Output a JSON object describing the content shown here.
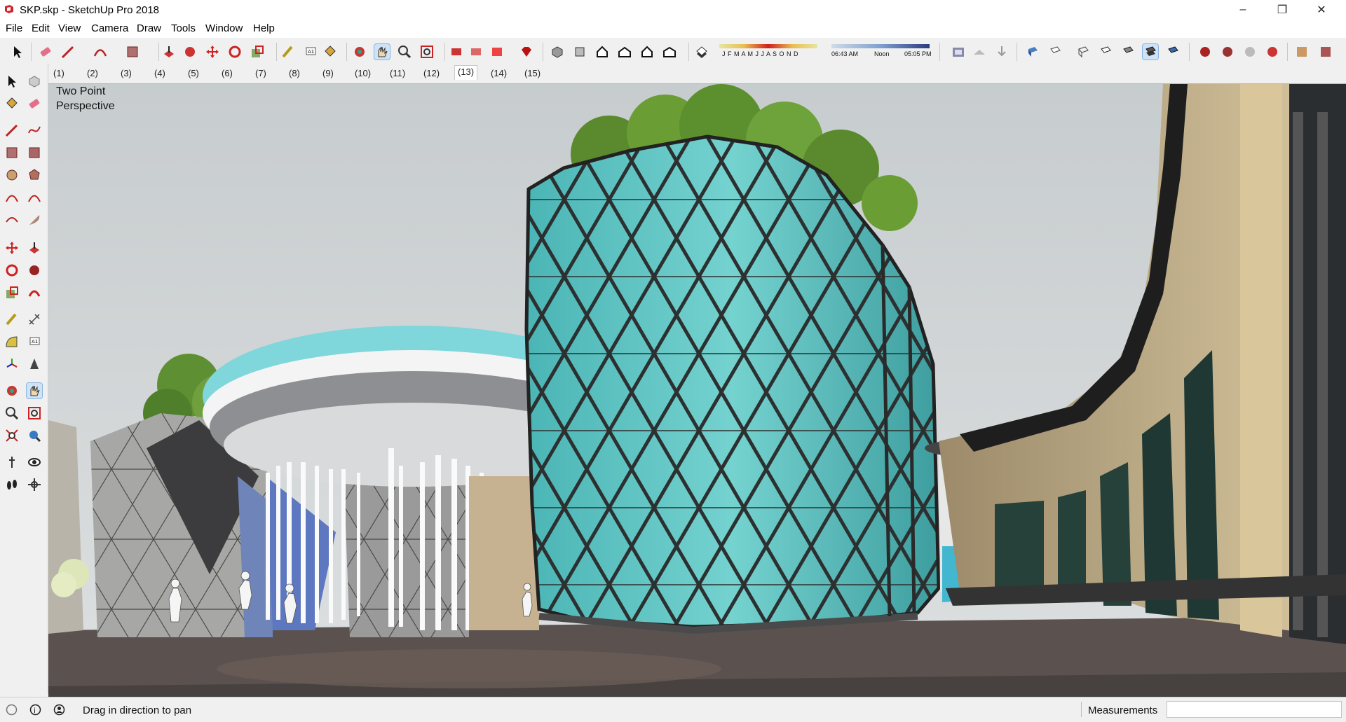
{
  "window": {
    "title": "SKP.skp - SketchUp Pro 2018",
    "controls": {
      "minimize": "–",
      "restore": "❐",
      "close": "✕"
    }
  },
  "menu": [
    "File",
    "Edit",
    "View",
    "Camera",
    "Draw",
    "Tools",
    "Window",
    "Help"
  ],
  "toolbar": {
    "shadow_months": "J F M A M J J A S O N D",
    "time_start": "06:43 AM",
    "time_noon": "Noon",
    "time_end": "05:05 PM"
  },
  "scenes": [
    "(1)",
    "(2)",
    "(3)",
    "(4)",
    "(5)",
    "(6)",
    "(7)",
    "(8)",
    "(9)",
    "(10)",
    "(11)",
    "(12)",
    "(13)",
    "(14)",
    "(15)"
  ],
  "active_scene": "(13)",
  "viewport": {
    "camera_line1": "Two Point",
    "camera_line2": "Perspective"
  },
  "statusbar": {
    "hint": "Drag in direction to pan",
    "measurements_label": "Measurements",
    "measurements_value": ""
  },
  "colors": {
    "accent_red": "#c8282a",
    "glass": "#5fc6c4",
    "frame": "#2a2a2a",
    "sky": "#cdd2d3"
  }
}
